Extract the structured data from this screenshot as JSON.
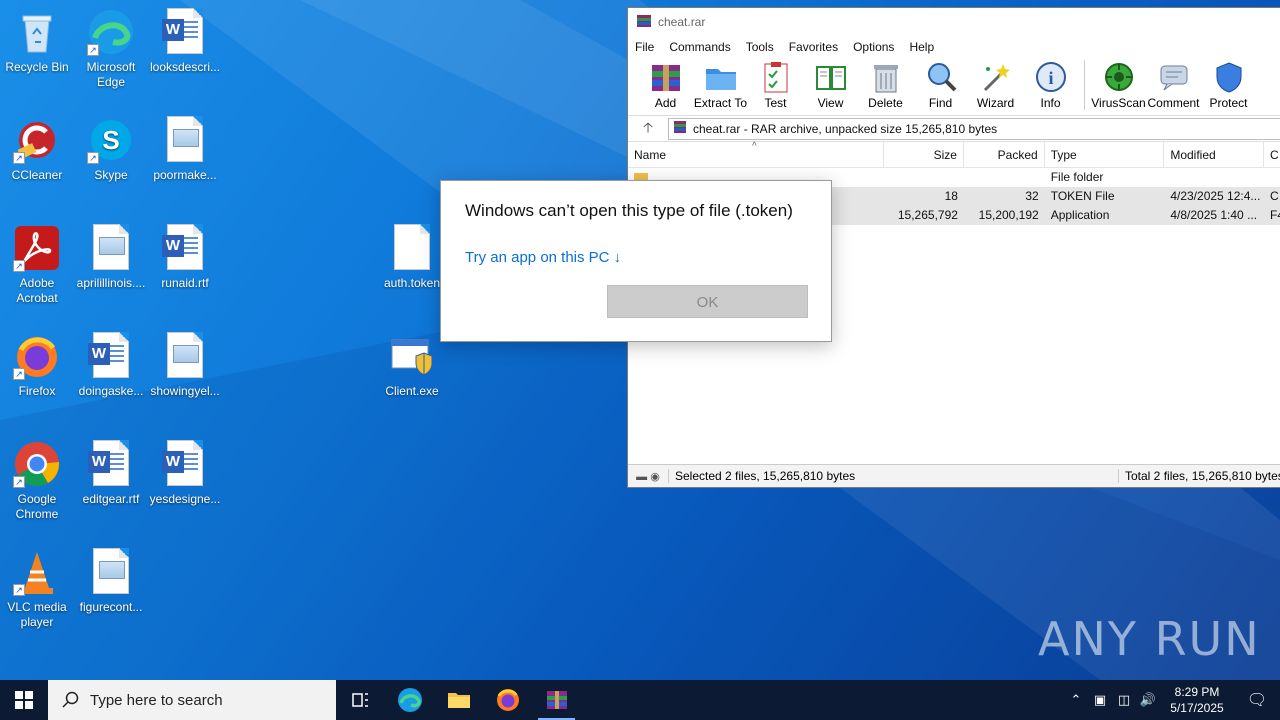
{
  "desktop": {
    "icons": [
      {
        "label": "Recycle Bin"
      },
      {
        "label": "Microsoft Edge"
      },
      {
        "label": "looksdescri..."
      },
      {
        "label": "CCleaner"
      },
      {
        "label": "Skype"
      },
      {
        "label": "poormake..."
      },
      {
        "label": "Adobe Acrobat"
      },
      {
        "label": "aprilillinois...."
      },
      {
        "label": "runaid.rtf"
      },
      {
        "label": "auth.token"
      },
      {
        "label": "Firefox"
      },
      {
        "label": "doingaske..."
      },
      {
        "label": "showingyel..."
      },
      {
        "label": "Client.exe"
      },
      {
        "label": "Google Chrome"
      },
      {
        "label": "editgear.rtf"
      },
      {
        "label": "yesdesigne..."
      },
      {
        "label": "VLC media player"
      },
      {
        "label": "figurecont..."
      }
    ]
  },
  "rar": {
    "title": "cheat.rar",
    "menu": [
      "File",
      "Commands",
      "Tools",
      "Favorites",
      "Options",
      "Help"
    ],
    "toolbar": [
      "Add",
      "Extract To",
      "Test",
      "View",
      "Delete",
      "Find",
      "Wizard",
      "Info",
      "VirusScan",
      "Comment",
      "Protect"
    ],
    "address": "cheat.rar - RAR archive, unpacked size 15,265,810 bytes",
    "columns": [
      "Name",
      "Size",
      "Packed",
      "Type",
      "Modified",
      "C"
    ],
    "rows": [
      {
        "name": "",
        "size": "",
        "packed": "",
        "type": "File folder",
        "modified": "",
        "crc": ""
      },
      {
        "name": "",
        "size": "18",
        "packed": "32",
        "type": "TOKEN File",
        "modified": "4/23/2025 12:4...",
        "crc": "C"
      },
      {
        "name": "",
        "size": "15,265,792",
        "packed": "15,200,192",
        "type": "Application",
        "modified": "4/8/2025 1:40 ...",
        "crc": "F4"
      }
    ],
    "status_left": "Selected 2 files, 15,265,810 bytes",
    "status_right": "Total 2 files, 15,265,810 bytes"
  },
  "dialog": {
    "title": "Windows can’t open this type of file (.token)",
    "link": "Try an app on this PC ↓",
    "ok": "OK"
  },
  "watermark": "ANY RUN",
  "taskbar": {
    "search_placeholder": "Type here to search",
    "time": "8:29 PM",
    "date": "5/17/2025"
  }
}
